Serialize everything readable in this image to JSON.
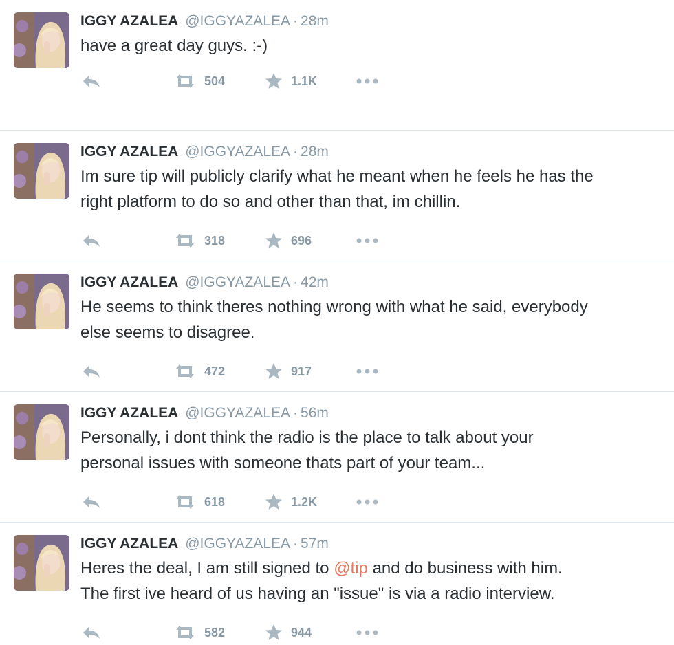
{
  "tweets": [
    {
      "fullname": "IGGY AZALEA",
      "username": "@IGGYAZALEA",
      "time": "28m",
      "lines": [
        "have a great day guys. :-)"
      ],
      "retweets": "504",
      "favorites": "1.1K"
    },
    {
      "fullname": "IGGY AZALEA",
      "username": "@IGGYAZALEA",
      "time": "28m",
      "lines": [
        "Im sure tip will publicly clarify what he meant when he feels he has the",
        "right platform to do so and other than that, im chillin."
      ],
      "retweets": "318",
      "favorites": "696"
    },
    {
      "fullname": "IGGY AZALEA",
      "username": "@IGGYAZALEA",
      "time": "42m",
      "lines": [
        "He seems to think theres nothing wrong with what he said, everybody",
        "else seems to disagree."
      ],
      "retweets": "472",
      "favorites": "917"
    },
    {
      "fullname": "IGGY AZALEA",
      "username": "@IGGYAZALEA",
      "time": "56m",
      "lines": [
        "Personally, i dont think the radio is the place to talk about your",
        "personal issues with someone thats part of your team..."
      ],
      "retweets": "618",
      "favorites": "1.2K"
    },
    {
      "fullname": "IGGY AZALEA",
      "username": "@IGGYAZALEA",
      "time": "57m",
      "line1_before": "Heres the deal, I am still signed to ",
      "line1_mention": "@tip",
      "line1_after": " and do business with him.",
      "lines": [
        "The first ive heard of us having an \"issue\" is via a radio interview."
      ],
      "retweets": "582",
      "favorites": "944"
    }
  ],
  "separator": "·",
  "colors": {
    "name": "#292f33",
    "meta": "#8899a6",
    "icon": "#aab8c2",
    "mention": "#e8795c",
    "divider": "#e1e8ed"
  },
  "icons": {
    "reply": "reply-icon",
    "retweet": "retweet-icon",
    "favorite": "star-icon",
    "more": "more-dots-icon"
  }
}
